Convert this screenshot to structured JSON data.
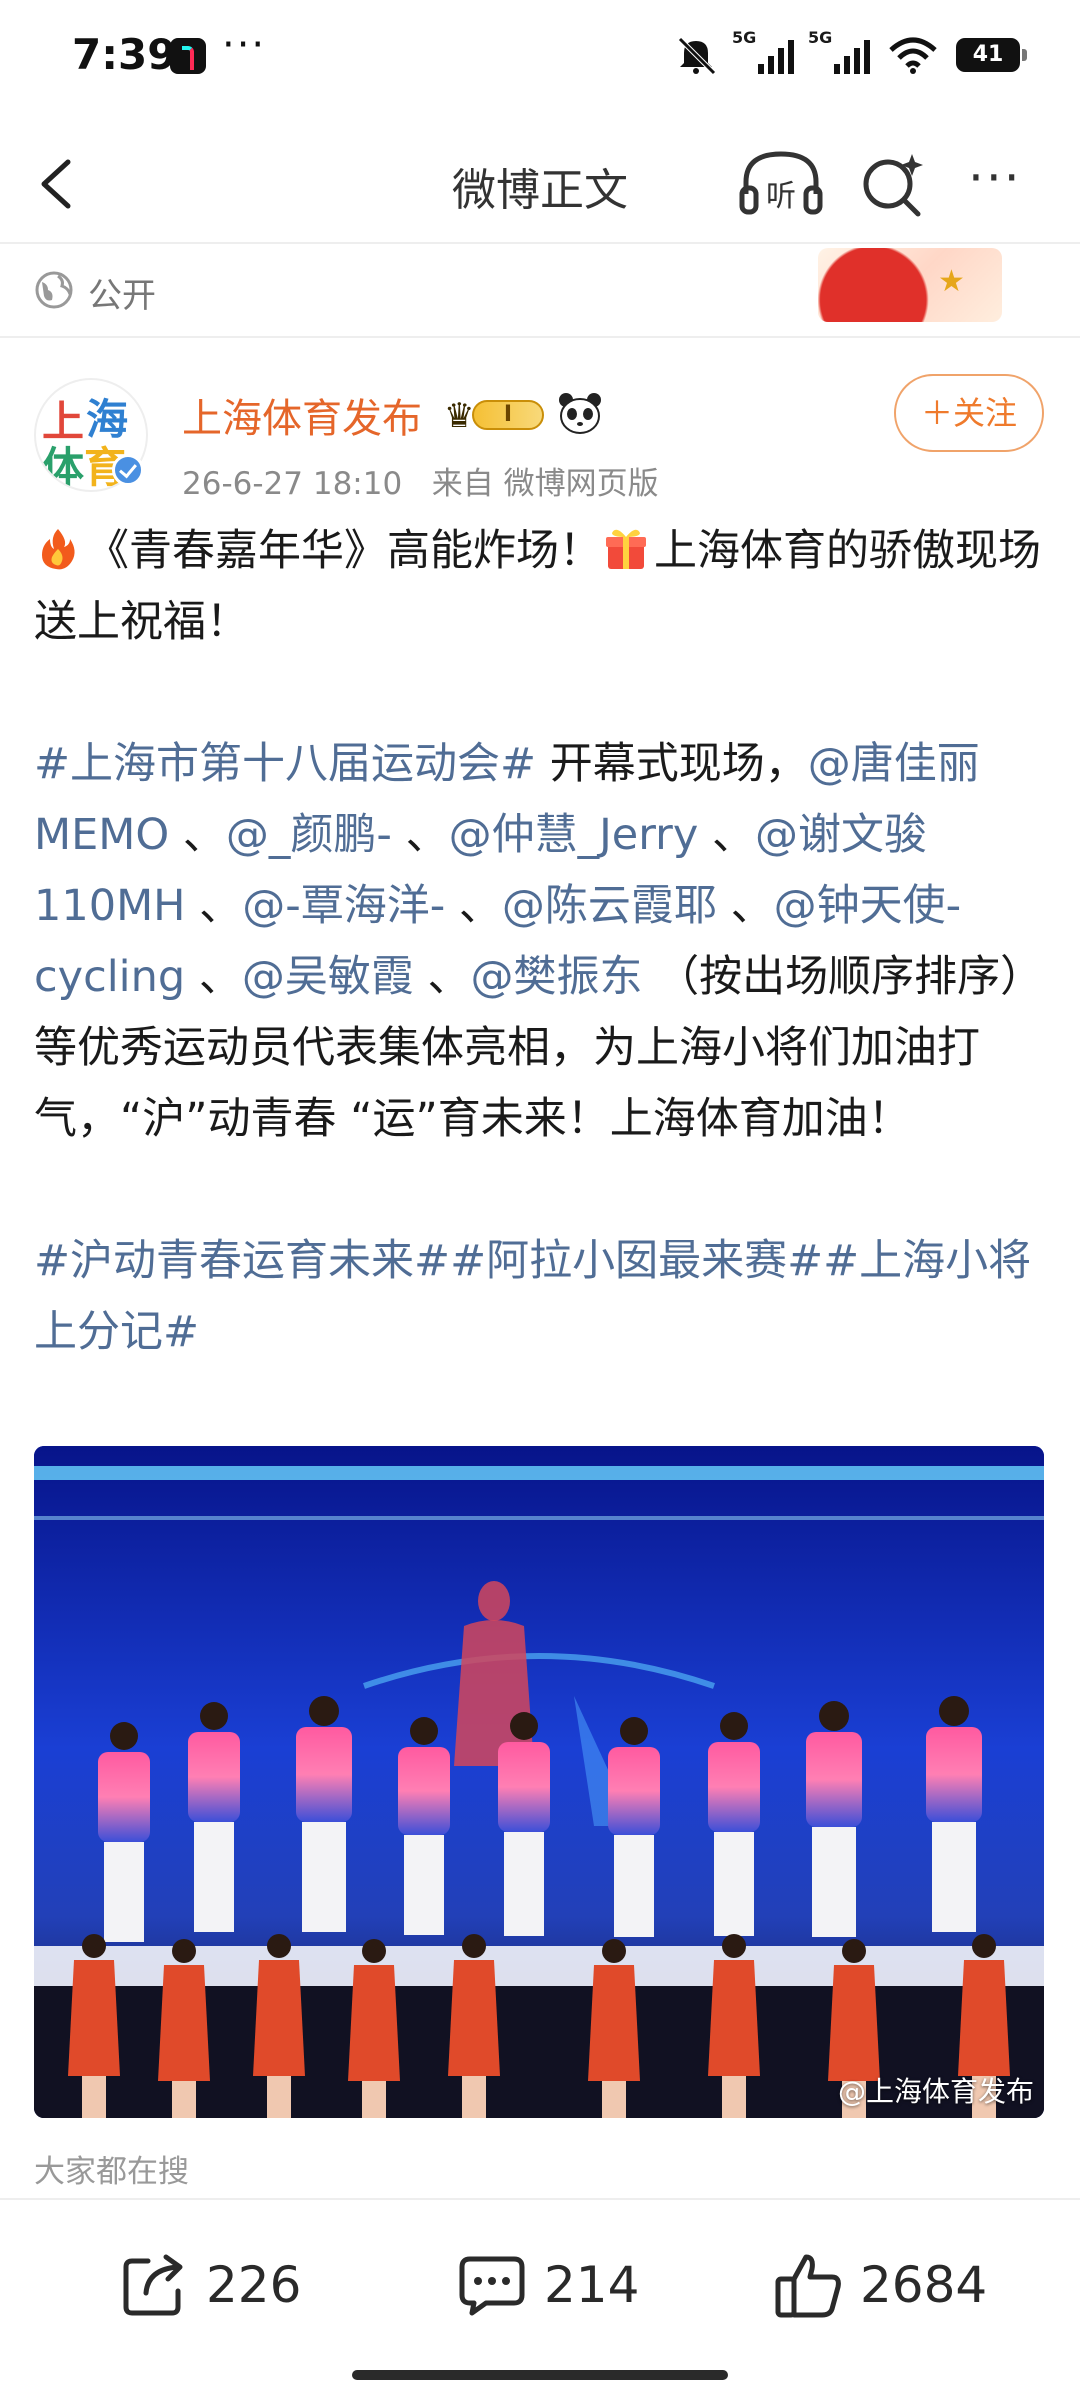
{
  "status_bar": {
    "time": "7:39",
    "dots": "···",
    "signal_1": "5G",
    "signal_2": "5G",
    "battery": "41"
  },
  "nav": {
    "title": "微博正文",
    "back_icon": "chevron-left-icon",
    "listen_icon": "headphones-listen-icon",
    "listen_label": "听",
    "search_icon": "search-spark-icon",
    "more_icon": "more-dots-icon",
    "more_label": "···"
  },
  "visibility": {
    "label": "公开",
    "icon": "globe-icon"
  },
  "author": {
    "name": "上海体育发布",
    "avatar_text": [
      "上",
      "海",
      "体",
      "育"
    ],
    "badge_label": "I",
    "date": "26-6-27 18:10",
    "source": "来自 微博网页版",
    "follow_label": "＋关注"
  },
  "post": {
    "line1_a": "《青春嘉年华》高能炸场！",
    "line1_b": "上海体育的骄傲现场送上祝福！",
    "tag_event": "#上海市第十八届运动会#",
    "text_opening": " 开幕式现场，",
    "mentions": [
      "@唐佳丽MEMO",
      "@_颜鹏-",
      "@仲慧_Jerry",
      "@谢文骏110MH",
      "@-覃海洋-",
      "@陈云霞耶",
      "@钟天使-cycling",
      "@吴敏霞",
      "@樊振东"
    ],
    "separator": " 、",
    "text_rest": " （按出场顺序排序）等优秀运动员代表集体亮相，为上海小将们加油打气，“沪”动青春 “运”育未来！上海体育加油！",
    "tags": [
      "#沪动青春运育未来#",
      "#阿拉小囡最来赛#",
      "#上海小将上分记#"
    ]
  },
  "photo": {
    "watermark": "@上海体育发布"
  },
  "search_hint": "大家都在搜",
  "actions": {
    "repost_count": "226",
    "comment_count": "214",
    "like_count": "2684"
  },
  "colors": {
    "accent_orange": "#ef7a2c",
    "username": "#e5662a",
    "tag_blue": "#506d95",
    "meta_gray": "#8a8a8a"
  }
}
